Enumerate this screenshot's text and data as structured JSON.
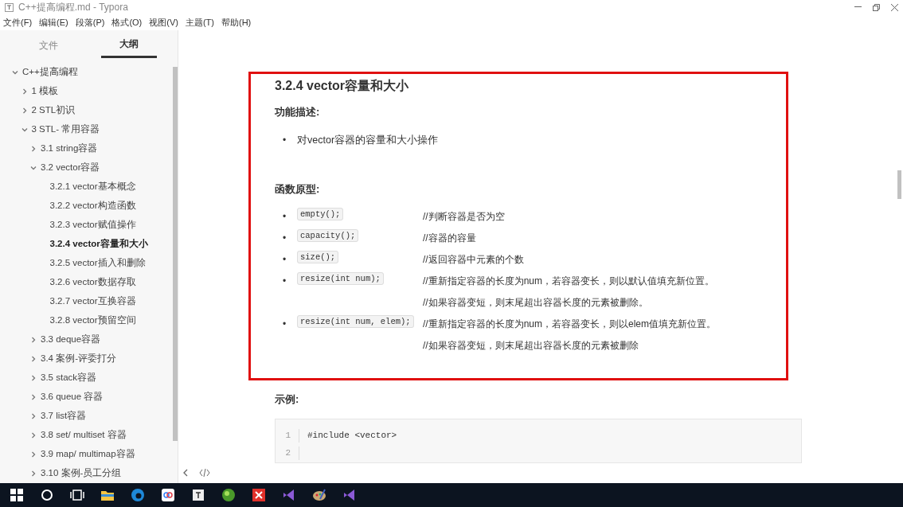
{
  "window": {
    "title": "C++提高编程.md - Typora"
  },
  "menu": [
    "文件(F)",
    "编辑(E)",
    "段落(P)",
    "格式(O)",
    "视图(V)",
    "主题(T)",
    "帮助(H)"
  ],
  "sidebar": {
    "tabs": [
      {
        "label": "文件",
        "selected": false
      },
      {
        "label": "大纲",
        "selected": true
      }
    ],
    "outline": [
      {
        "label": "C++提高编程",
        "expanded": true,
        "selected": false,
        "children": [
          {
            "label": "1 模板",
            "expanded": false,
            "selected": false
          },
          {
            "label": "2 STL初识",
            "expanded": false,
            "selected": false
          },
          {
            "label": "3 STL- 常用容器",
            "expanded": true,
            "selected": false,
            "children": [
              {
                "label": "3.1 string容器",
                "expanded": false,
                "selected": false
              },
              {
                "label": "3.2 vector容器",
                "expanded": true,
                "selected": false,
                "children": [
                  {
                    "label": "3.2.1 vector基本概念",
                    "selected": false
                  },
                  {
                    "label": "3.2.2 vector构造函数",
                    "selected": false
                  },
                  {
                    "label": "3.2.3 vector赋值操作",
                    "selected": false
                  },
                  {
                    "label": "3.2.4 vector容量和大小",
                    "selected": true
                  },
                  {
                    "label": "3.2.5 vector插入和删除",
                    "selected": false
                  },
                  {
                    "label": "3.2.6 vector数据存取",
                    "selected": false
                  },
                  {
                    "label": "3.2.7 vector互换容器",
                    "selected": false
                  },
                  {
                    "label": "3.2.8 vector预留空间",
                    "selected": false
                  }
                ]
              },
              {
                "label": "3.3 deque容器",
                "expanded": false,
                "selected": false
              },
              {
                "label": "3.4 案例-评委打分",
                "expanded": false,
                "selected": false
              },
              {
                "label": "3.5 stack容器",
                "expanded": false,
                "selected": false
              },
              {
                "label": "3.6 queue 容器",
                "expanded": false,
                "selected": false
              },
              {
                "label": "3.7 list容器",
                "expanded": false,
                "selected": false
              },
              {
                "label": "3.8 set/ multiset 容器",
                "expanded": false,
                "selected": false
              },
              {
                "label": "3.9 map/ multimap容器",
                "expanded": false,
                "selected": false
              },
              {
                "label": "3.10 案例-员工分组",
                "expanded": false,
                "selected": false
              }
            ]
          }
        ]
      }
    ]
  },
  "document": {
    "heading": "3.2.4  vector容量和大小",
    "description_title": "功能描述:",
    "description_items": [
      {
        "marker": "•",
        "text": "对vector容器的容量和大小操作"
      }
    ],
    "prototypes_title": "函数原型:",
    "prototypes": [
      {
        "marker": "•",
        "code": "empty();",
        "comments": [
          "//判断容器是否为空"
        ]
      },
      {
        "marker": "•",
        "code": "capacity();",
        "comments": [
          "//容器的容量"
        ]
      },
      {
        "marker": "•",
        "code": "size();",
        "comments": [
          "//返回容器中元素的个数"
        ]
      },
      {
        "marker": "•",
        "code": "resize(int num);",
        "comments": [
          "//重新指定容器的长度为num，若容器变长，则以默认值填充新位置。",
          "//如果容器变短，则末尾超出容器长度的元素被删除。"
        ]
      },
      {
        "marker": "•",
        "code": "resize(int num, elem);",
        "comments": [
          "//重新指定容器的长度为num，若容器变长，则以elem值填充新位置。",
          "//如果容器变短，则末尾超出容器长度的元素被删除"
        ]
      }
    ],
    "example_title": "示例:",
    "code_lines": [
      {
        "number": "1",
        "text": "#include <vector>"
      },
      {
        "number": "2"
      }
    ]
  }
}
